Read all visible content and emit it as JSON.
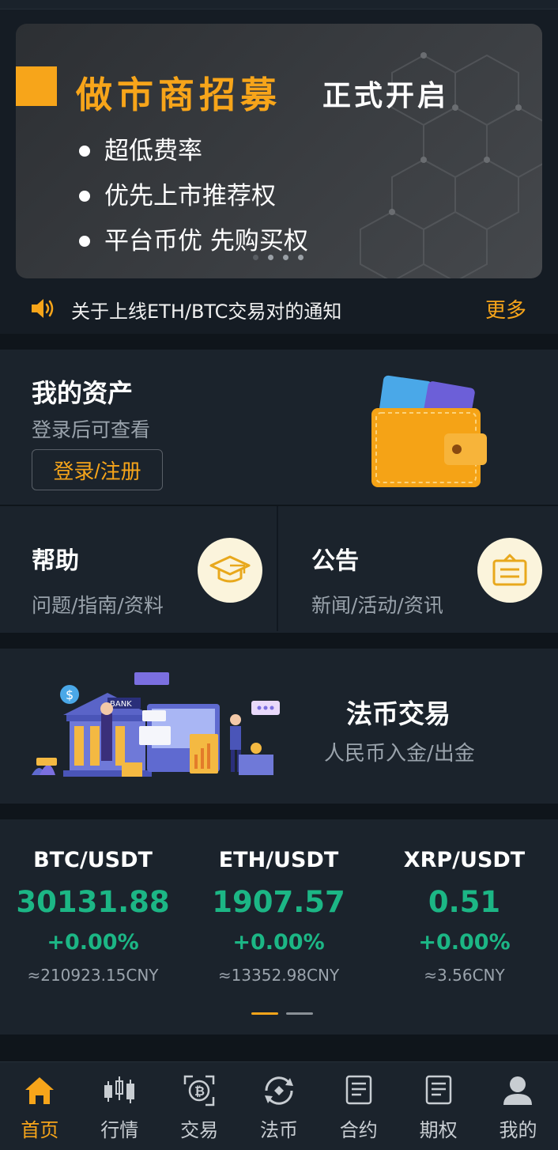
{
  "banner": {
    "title": "做市商招募",
    "subtitle": "正式开启",
    "bullets": [
      "超低费率",
      "优先上市推荐权",
      "平台币优 先购买权"
    ]
  },
  "notice": {
    "text": "关于上线ETH/BTC交易对的通知",
    "more": "更多"
  },
  "assets": {
    "title": "我的资产",
    "subtitle": "登录后可查看",
    "login_button": "登录/注册"
  },
  "help": {
    "title": "帮助",
    "subtitle": "问题/指南/资料"
  },
  "announcement": {
    "title": "公告",
    "subtitle": "新闻/活动/资讯"
  },
  "fiat": {
    "title": "法币交易",
    "subtitle": "人民币入金/出金",
    "illustration_text": "BANK"
  },
  "tickers": [
    {
      "pair": "BTC/USDT",
      "price": "30131.88",
      "change": "+0.00%",
      "cny": "≈210923.15CNY"
    },
    {
      "pair": "ETH/USDT",
      "price": "1907.57",
      "change": "+0.00%",
      "cny": "≈13352.98CNY"
    },
    {
      "pair": "XRP/USDT",
      "price": "0.51",
      "change": "+0.00%",
      "cny": "≈3.56CNY"
    }
  ],
  "tabs": [
    {
      "label": "首页",
      "icon": "home-icon",
      "active": true
    },
    {
      "label": "行情",
      "icon": "candlestick-icon"
    },
    {
      "label": "交易",
      "icon": "bitcoin-exchange-icon"
    },
    {
      "label": "法币",
      "icon": "fiat-swap-icon"
    },
    {
      "label": "合约",
      "icon": "contract-icon"
    },
    {
      "label": "期权",
      "icon": "options-icon"
    },
    {
      "label": "我的",
      "icon": "user-icon"
    }
  ],
  "colors": {
    "accent": "#f7a51a",
    "up": "#1cb685",
    "background": "#151c24",
    "panel": "#1b232c"
  }
}
